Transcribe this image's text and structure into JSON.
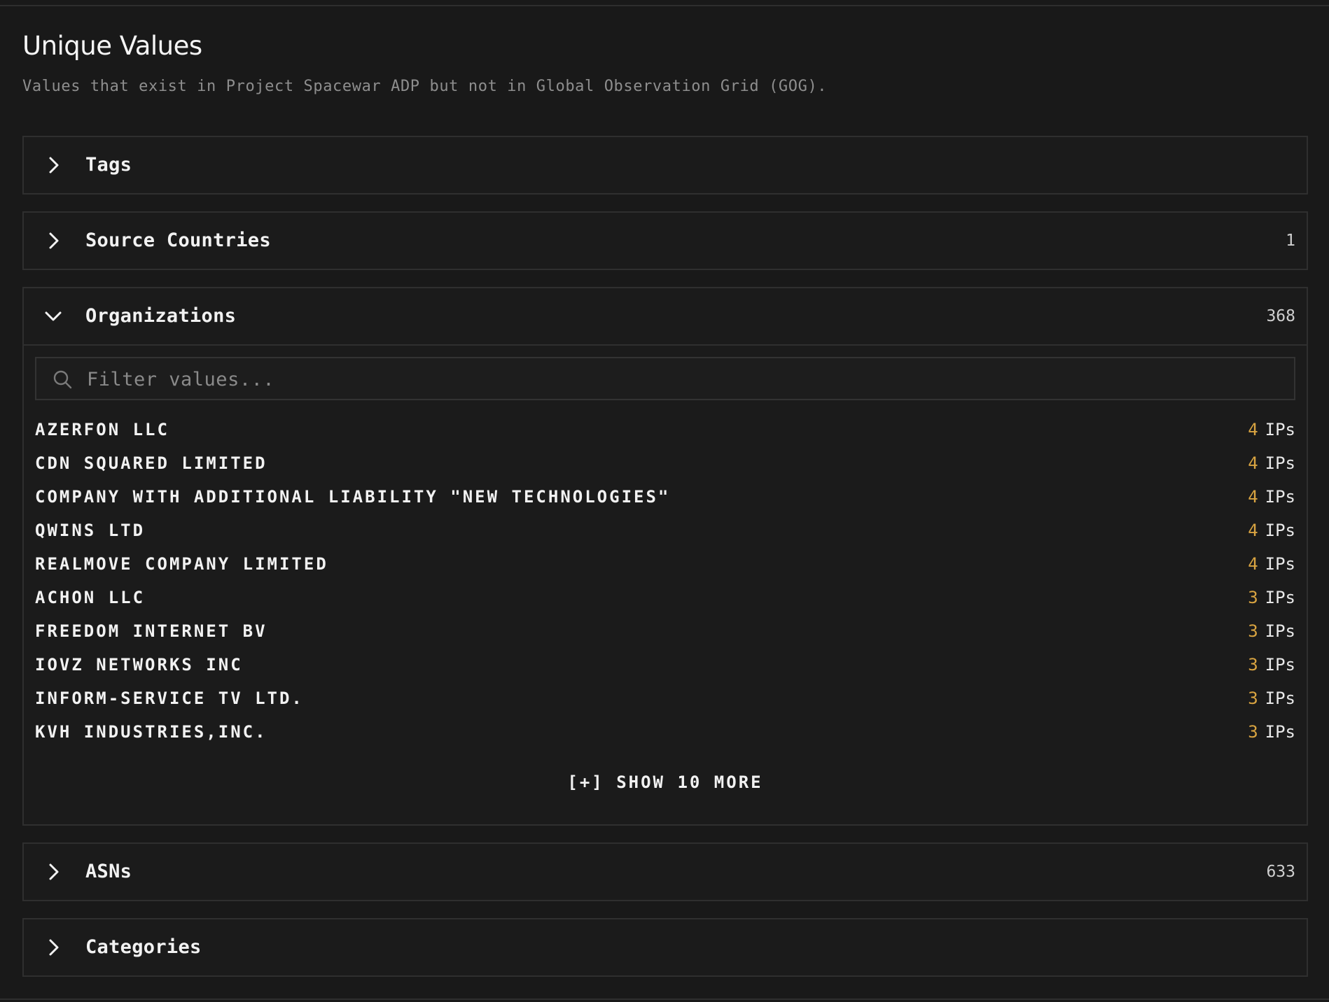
{
  "title": "Unique Values",
  "subtitle": "Values that exist in Project Spacewar ADP but not in Global Observation Grid (GOG).",
  "colors": {
    "background": "#191919",
    "count_accent": "#d9a441",
    "border": "#2f2f2f"
  },
  "sections": [
    {
      "label": "Tags",
      "count": "",
      "expanded": false,
      "icon": "chevron-right-icon"
    },
    {
      "label": "Source Countries",
      "count": "1",
      "expanded": false,
      "icon": "chevron-right-icon"
    },
    {
      "label": "Organizations",
      "count": "368",
      "expanded": true,
      "icon": "chevron-down-icon"
    },
    {
      "label": "ASNs",
      "count": "633",
      "expanded": false,
      "icon": "chevron-right-icon"
    },
    {
      "label": "Categories",
      "count": "",
      "expanded": false,
      "icon": "chevron-right-icon"
    }
  ],
  "organizations": {
    "filter_placeholder": "Filter values...",
    "filter_value": "",
    "search_icon": "search-icon",
    "ips_unit": "IPs",
    "items": [
      {
        "name": "AZERFON LLC",
        "ips": "4"
      },
      {
        "name": "CDN SQUARED LIMITED",
        "ips": "4"
      },
      {
        "name": "COMPANY WITH ADDITIONAL LIABILITY \"NEW TECHNOLOGIES\"",
        "ips": "4"
      },
      {
        "name": "QWINS LTD",
        "ips": "4"
      },
      {
        "name": "REALMOVE COMPANY LIMITED",
        "ips": "4"
      },
      {
        "name": "ACHON LLC",
        "ips": "3"
      },
      {
        "name": "FREEDOM INTERNET BV",
        "ips": "3"
      },
      {
        "name": "IOVZ NETWORKS INC",
        "ips": "3"
      },
      {
        "name": "INFORM-SERVICE TV LTD.",
        "ips": "3"
      },
      {
        "name": "KVH INDUSTRIES,INC.",
        "ips": "3"
      }
    ],
    "show_more_label": "[+] SHOW 10 MORE"
  }
}
